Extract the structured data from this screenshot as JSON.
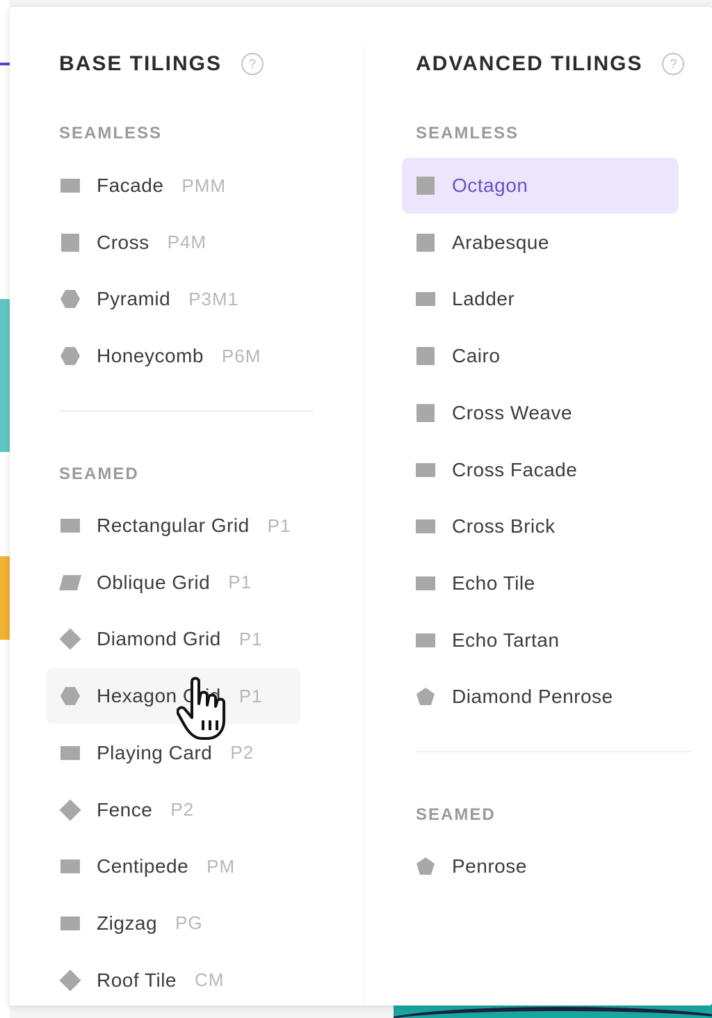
{
  "base": {
    "title": "BASE TILINGS",
    "seamless_label": "SEAMLESS",
    "seamed_label": "SEAMED",
    "seamless": [
      {
        "name": "Facade",
        "code": "PMM",
        "shape": "rect"
      },
      {
        "name": "Cross",
        "code": "P4M",
        "shape": "square"
      },
      {
        "name": "Pyramid",
        "code": "P3M1",
        "shape": "hexagon"
      },
      {
        "name": "Honeycomb",
        "code": "P6M",
        "shape": "hexagon"
      }
    ],
    "seamed": [
      {
        "name": "Rectangular Grid",
        "code": "P1",
        "shape": "rect"
      },
      {
        "name": "Oblique Grid",
        "code": "P1",
        "shape": "parallelogram"
      },
      {
        "name": "Diamond Grid",
        "code": "P1",
        "shape": "diamond"
      },
      {
        "name": "Hexagon Grid",
        "code": "P1",
        "shape": "hexagon"
      },
      {
        "name": "Playing Card",
        "code": "P2",
        "shape": "rect"
      },
      {
        "name": "Fence",
        "code": "P2",
        "shape": "diamond"
      },
      {
        "name": "Centipede",
        "code": "PM",
        "shape": "rect"
      },
      {
        "name": "Zigzag",
        "code": "PG",
        "shape": "rect"
      },
      {
        "name": "Roof Tile",
        "code": "CM",
        "shape": "diamond"
      }
    ]
  },
  "advanced": {
    "title": "ADVANCED TILINGS",
    "seamless_label": "SEAMLESS",
    "seamed_label": "SEAMED",
    "seamless": [
      {
        "name": "Octagon",
        "shape": "square",
        "selected": true
      },
      {
        "name": "Arabesque",
        "shape": "square"
      },
      {
        "name": "Ladder",
        "shape": "rect"
      },
      {
        "name": "Cairo",
        "shape": "square"
      },
      {
        "name": "Cross Weave",
        "shape": "square"
      },
      {
        "name": "Cross Facade",
        "shape": "rect"
      },
      {
        "name": "Cross Brick",
        "shape": "rect"
      },
      {
        "name": "Echo Tile",
        "shape": "rect"
      },
      {
        "name": "Echo Tartan",
        "shape": "rect"
      },
      {
        "name": "Diamond Penrose",
        "shape": "pentagon"
      }
    ],
    "seamed": [
      {
        "name": "Penrose",
        "shape": "pentagon"
      }
    ]
  },
  "help_glyph": "?",
  "hover_item": "Hexagon Grid",
  "colors": {
    "accent": "#6a52c7",
    "selected_bg": "#ebe6fb",
    "shape": "#a8a8a8"
  }
}
